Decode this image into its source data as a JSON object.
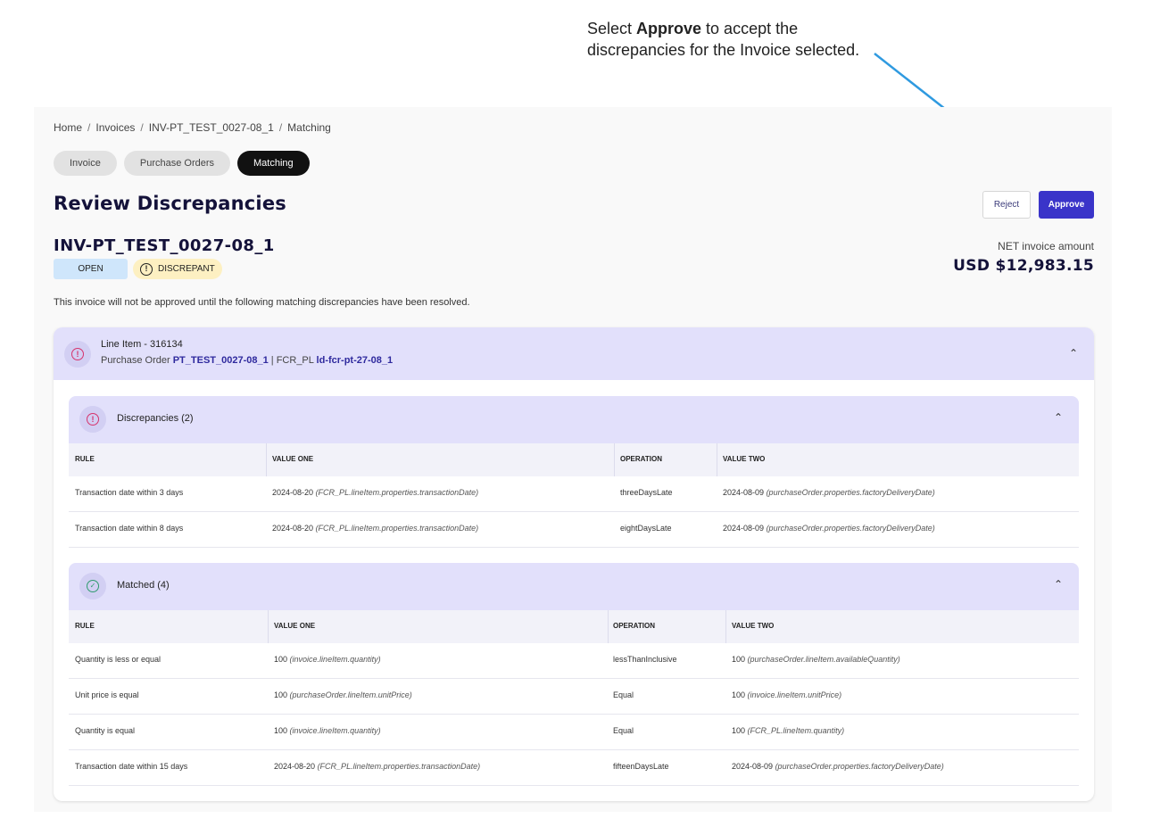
{
  "callout": {
    "prefix": "Select ",
    "bold": "Approve",
    "suffix": " to accept the",
    "line2": "discrepancies for the Invoice selected."
  },
  "breadcrumb": [
    "Home",
    "Invoices",
    "INV-PT_TEST_0027-08_1",
    "Matching"
  ],
  "tabs": [
    {
      "label": "Invoice",
      "active": false
    },
    {
      "label": "Purchase Orders",
      "active": false
    },
    {
      "label": "Matching",
      "active": true
    }
  ],
  "page_title": "Review Discrepancies",
  "actions": {
    "reject": "Reject",
    "approve": "Approve"
  },
  "invoice": {
    "id": "INV-PT_TEST_0027-08_1",
    "status": "OPEN",
    "flag": "DISCREPANT",
    "net_label": "NET invoice amount",
    "net_amount": "USD $12,983.15"
  },
  "notice": "This invoice will not be approved until the following matching discrepancies have been resolved.",
  "line_item": {
    "title": "Line Item - 316134",
    "po_label": "Purchase Order",
    "po_value": "PT_TEST_0027-08_1",
    "fcr_label": "| FCR_PL",
    "fcr_value": "ld-fcr-pt-27-08_1"
  },
  "discrepancies": {
    "title": "Discrepancies (2)",
    "columns": [
      "RULE",
      "VALUE ONE",
      "OPERATION",
      "VALUE TWO"
    ],
    "rows": [
      {
        "rule": "Transaction date within 3 days",
        "v1": "2024-08-20",
        "v1_path": "(FCR_PL.lineItem.properties.transactionDate)",
        "op": "threeDaysLate",
        "v2": "2024-08-09",
        "v2_path": "(purchaseOrder.properties.factoryDeliveryDate)"
      },
      {
        "rule": "Transaction date within 8 days",
        "v1": "2024-08-20",
        "v1_path": "(FCR_PL.lineItem.properties.transactionDate)",
        "op": "eightDaysLate",
        "v2": "2024-08-09",
        "v2_path": "(purchaseOrder.properties.factoryDeliveryDate)"
      }
    ]
  },
  "matched": {
    "title": "Matched (4)",
    "columns": [
      "RULE",
      "VALUE ONE",
      "OPERATION",
      "VALUE TWO"
    ],
    "rows": [
      {
        "rule": "Quantity is less or equal",
        "v1": "100",
        "v1_path": "(invoice.lineItem.quantity)",
        "op": "lessThanInclusive",
        "v2": "100",
        "v2_path": "(purchaseOrder.lineItem.availableQuantity)"
      },
      {
        "rule": "Unit price is equal",
        "v1": "100",
        "v1_path": "(purchaseOrder.lineItem.unitPrice)",
        "op": "Equal",
        "v2": "100",
        "v2_path": "(invoice.lineItem.unitPrice)"
      },
      {
        "rule": "Quantity is equal",
        "v1": "100",
        "v1_path": "(invoice.lineItem.quantity)",
        "op": "Equal",
        "v2": "100",
        "v2_path": "(FCR_PL.lineItem.quantity)"
      },
      {
        "rule": "Transaction date within 15 days",
        "v1": "2024-08-20",
        "v1_path": "(FCR_PL.lineItem.properties.transactionDate)",
        "op": "fifteenDaysLate",
        "v2": "2024-08-09",
        "v2_path": "(purchaseOrder.properties.factoryDeliveryDate)"
      }
    ]
  },
  "colors": {
    "accent": "#3a34c9",
    "header_bg": "#e2e0fb",
    "open_badge": "#cfe6fb",
    "discrepant_badge": "#fdf0c2",
    "arrow": "#2f9ae0"
  }
}
